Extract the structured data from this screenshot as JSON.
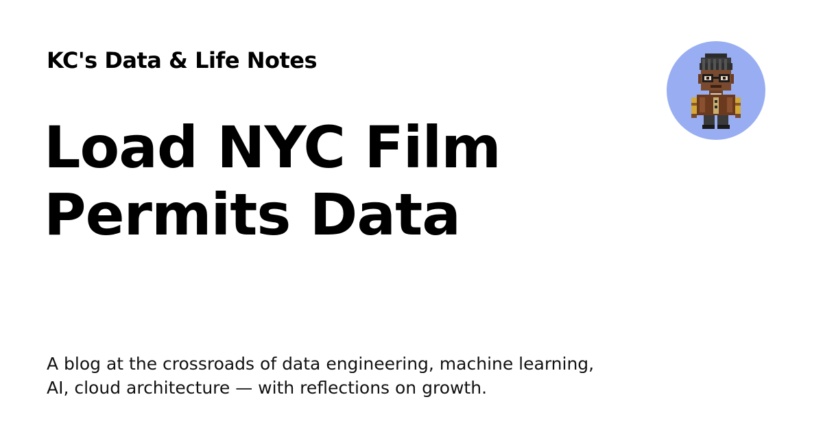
{
  "site": {
    "title": "KC's Data & Life Notes"
  },
  "post": {
    "title_line1": "Load NYC Film",
    "title_line2": "Permits Data"
  },
  "description": {
    "line1": "A blog at the crossroads of data engineering, machine learning,",
    "line2": "AI, cloud architecture — with reflections on growth."
  },
  "avatar": {
    "icon": "pixel-art-avatar-icon",
    "background_color": "#99aef2"
  },
  "colors": {
    "background": "#ffffff",
    "text": "#000000"
  }
}
